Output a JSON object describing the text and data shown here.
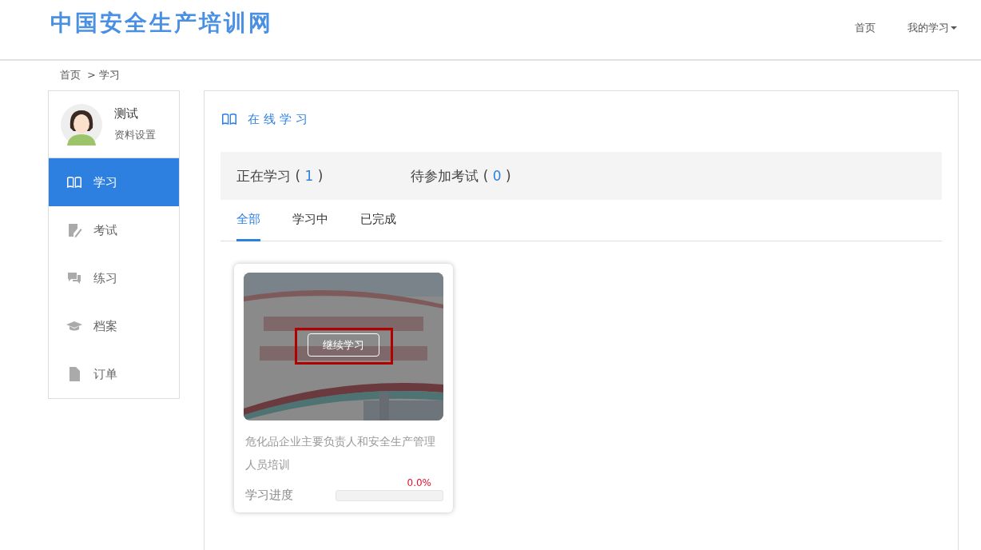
{
  "header": {
    "logo": "中国安全生产培训网",
    "nav": [
      {
        "label": "首页",
        "dropdown": false
      },
      {
        "label": "我的学习",
        "dropdown": true
      }
    ]
  },
  "breadcrumb": [
    "首页",
    "> 学习"
  ],
  "profile": {
    "name": "测试",
    "settings": "资料设置"
  },
  "sidebar": {
    "items": [
      {
        "label": "学习",
        "kind": "book",
        "selected": true
      },
      {
        "label": "考试",
        "kind": "edit",
        "selected": false
      },
      {
        "label": "练习",
        "kind": "chat",
        "selected": false
      },
      {
        "label": "档案",
        "kind": "cap",
        "selected": false
      },
      {
        "label": "订单",
        "kind": "doc",
        "selected": false
      }
    ]
  },
  "panel": {
    "title": "在线学习",
    "tabs": [
      {
        "label": "正在学习 (",
        "count": "1",
        "close": ")"
      },
      {
        "label": "待参加考试 (",
        "count": "0",
        "close": ")"
      }
    ],
    "subtabs": [
      {
        "label": "全部",
        "selected": true
      },
      {
        "label": "学习中",
        "selected": false
      },
      {
        "label": "已完成",
        "selected": false
      }
    ],
    "courses": [
      {
        "kind": "picture",
        "button": "继续学习",
        "highlighted": true,
        "title": "危化品企业主要负责人和安全生产管理人员培训",
        "progress_label": "学习进度",
        "percent": "0.0%",
        "level": 0
      }
    ]
  }
}
